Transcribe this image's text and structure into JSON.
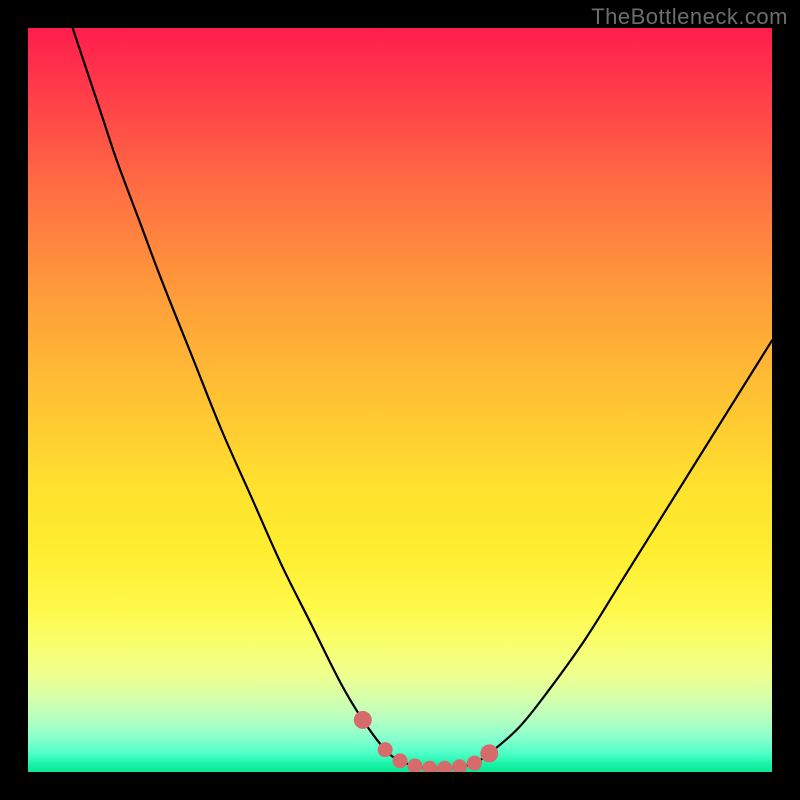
{
  "watermark": "TheBottleneck.com",
  "colors": {
    "background": "#000000",
    "curve": "#000000",
    "marker": "#d76b6b",
    "gradient_top": "#ff1d4d",
    "gradient_mid": "#ffe22e",
    "gradient_bottom": "#0be794"
  },
  "chart_data": {
    "type": "line",
    "title": "",
    "xlabel": "",
    "ylabel": "",
    "xlim": [
      0,
      100
    ],
    "ylim": [
      0,
      100
    ],
    "annotations": [],
    "series": [
      {
        "name": "bottleneck-curve",
        "x": [
          6,
          8,
          10,
          12,
          15,
          18,
          22,
          26,
          30,
          34,
          38,
          42,
          45,
          48,
          50,
          52,
          54,
          56,
          58,
          60,
          62,
          66,
          70,
          75,
          80,
          85,
          90,
          95,
          100
        ],
        "y": [
          100,
          94,
          88,
          82,
          74,
          66,
          56,
          46,
          37,
          28,
          20,
          12,
          7,
          3,
          1.5,
          0.8,
          0.5,
          0.5,
          0.7,
          1.2,
          2.5,
          6,
          11,
          18,
          26,
          34,
          42,
          50,
          58
        ]
      }
    ],
    "optimum_markers_x": [
      45,
      48,
      50,
      52,
      54,
      56,
      58,
      60,
      62
    ],
    "legend": []
  }
}
